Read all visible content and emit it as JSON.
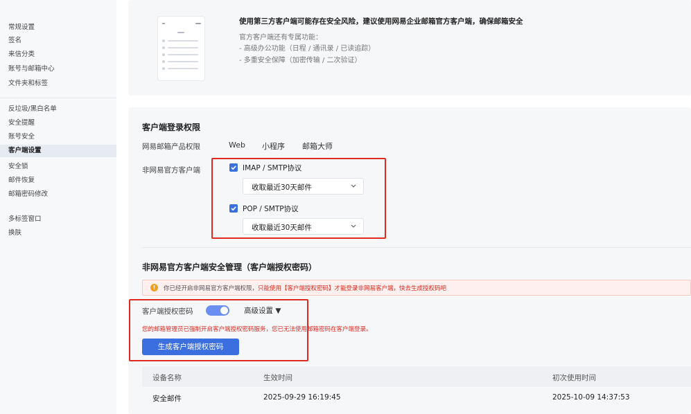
{
  "sidebar": {
    "group1": [
      "常规设置",
      "签名",
      "来信分类",
      "账号与邮箱中心",
      "文件夹和标签"
    ],
    "group2": [
      "反垃圾/黑白名单",
      "安全提醒",
      "账号安全",
      "客户端设置",
      "安全锁",
      "邮件恢复",
      "邮箱密码修改"
    ],
    "group3": [
      "多标签窗口",
      "换肤"
    ],
    "active": "客户端设置"
  },
  "notice": {
    "title": "使用第三方客户端可能存在安全风险，建议使用网易企业邮箱官方客户端，确保邮箱安全",
    "subtitle": "官方客户端还有专属功能：",
    "line1": "- 高级办公功能（日程 / 通讯录 / 已读追踪）",
    "line2": "- 多重安全保障（加密传输 / 二次验证）"
  },
  "login_perm": {
    "title": "客户端登录权限",
    "product_label": "网易邮箱产品权限",
    "products": [
      "Web",
      "小程序",
      "邮箱大师"
    ],
    "third_party_label": "非网易官方客户端",
    "imap_label": "IMAP / SMTP协议",
    "imap_select": "收取最近30天邮件",
    "pop_label": "POP / SMTP协议",
    "pop_select": "收取最近30天邮件"
  },
  "security": {
    "title": "非网易官方客户端安全管理（客户端授权密码）",
    "warning_pre": "你已经开启非网易官方客户端权限，",
    "warning_hl": "只能使用【客户端授权密码】才能登录非网易客户端，快去生成授权码吧",
    "auth_label": "客户端授权密码",
    "advanced": "高级设置 ▼",
    "error_text": "您的邮箱管理员已强制开启客户端授权密码服务，您已无法使用邮箱密码在客户端登录。",
    "generate_btn": "生成客户端授权密码"
  },
  "table": {
    "headers": [
      "设备名称",
      "生效时间",
      "初次使用时间"
    ],
    "rows": [
      [
        "安全邮件",
        "2025-09-29 16:19:45",
        "2025-10-09 14:37:53"
      ]
    ]
  },
  "colors": {
    "accent": "#3b6fe0",
    "danger": "#e0291e",
    "warning": "#f0a020"
  }
}
